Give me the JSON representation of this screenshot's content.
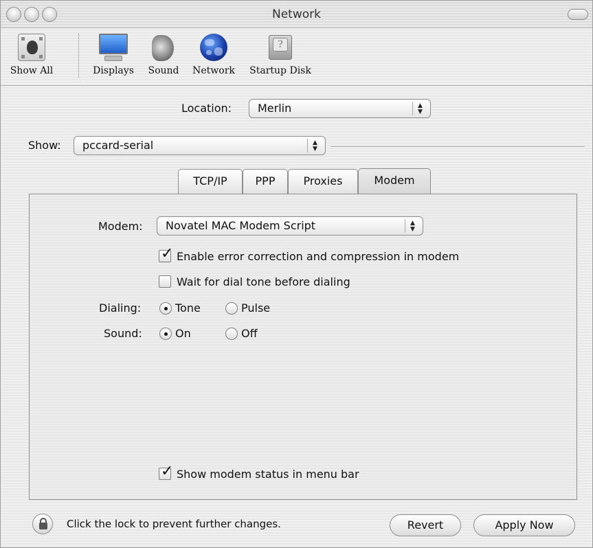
{
  "window": {
    "title": "Network"
  },
  "toolbar": {
    "items": [
      {
        "label": "Show All",
        "icon": "show-all-icon"
      },
      {
        "label": "Displays",
        "icon": "displays-icon"
      },
      {
        "label": "Sound",
        "icon": "sound-icon"
      },
      {
        "label": "Network",
        "icon": "network-globe-icon"
      },
      {
        "label": "Startup Disk",
        "icon": "startup-disk-icon"
      }
    ]
  },
  "location": {
    "label": "Location:",
    "value": "Merlin"
  },
  "show": {
    "label": "Show:",
    "value": "pccard-serial"
  },
  "tabs": [
    {
      "label": "TCP/IP",
      "active": false
    },
    {
      "label": "PPP",
      "active": false
    },
    {
      "label": "Proxies",
      "active": false
    },
    {
      "label": "Modem",
      "active": true
    }
  ],
  "modem": {
    "modem_label": "Modem:",
    "modem_value": "Novatel MAC Modem Script",
    "error_correction": {
      "label": "Enable error correction and compression in modem",
      "checked": true
    },
    "wait_dial_tone": {
      "label": "Wait for dial tone before dialing",
      "checked": false
    },
    "dialing": {
      "label": "Dialing:",
      "options": [
        "Tone",
        "Pulse"
      ],
      "selected": "Tone"
    },
    "sound": {
      "label": "Sound:",
      "options": [
        "On",
        "Off"
      ],
      "selected": "On"
    },
    "status_menu": {
      "label": "Show modem status in menu bar",
      "checked": true
    }
  },
  "footer": {
    "lock_text": "Click the lock to prevent further changes.",
    "revert_label": "Revert",
    "apply_label": "Apply Now"
  }
}
